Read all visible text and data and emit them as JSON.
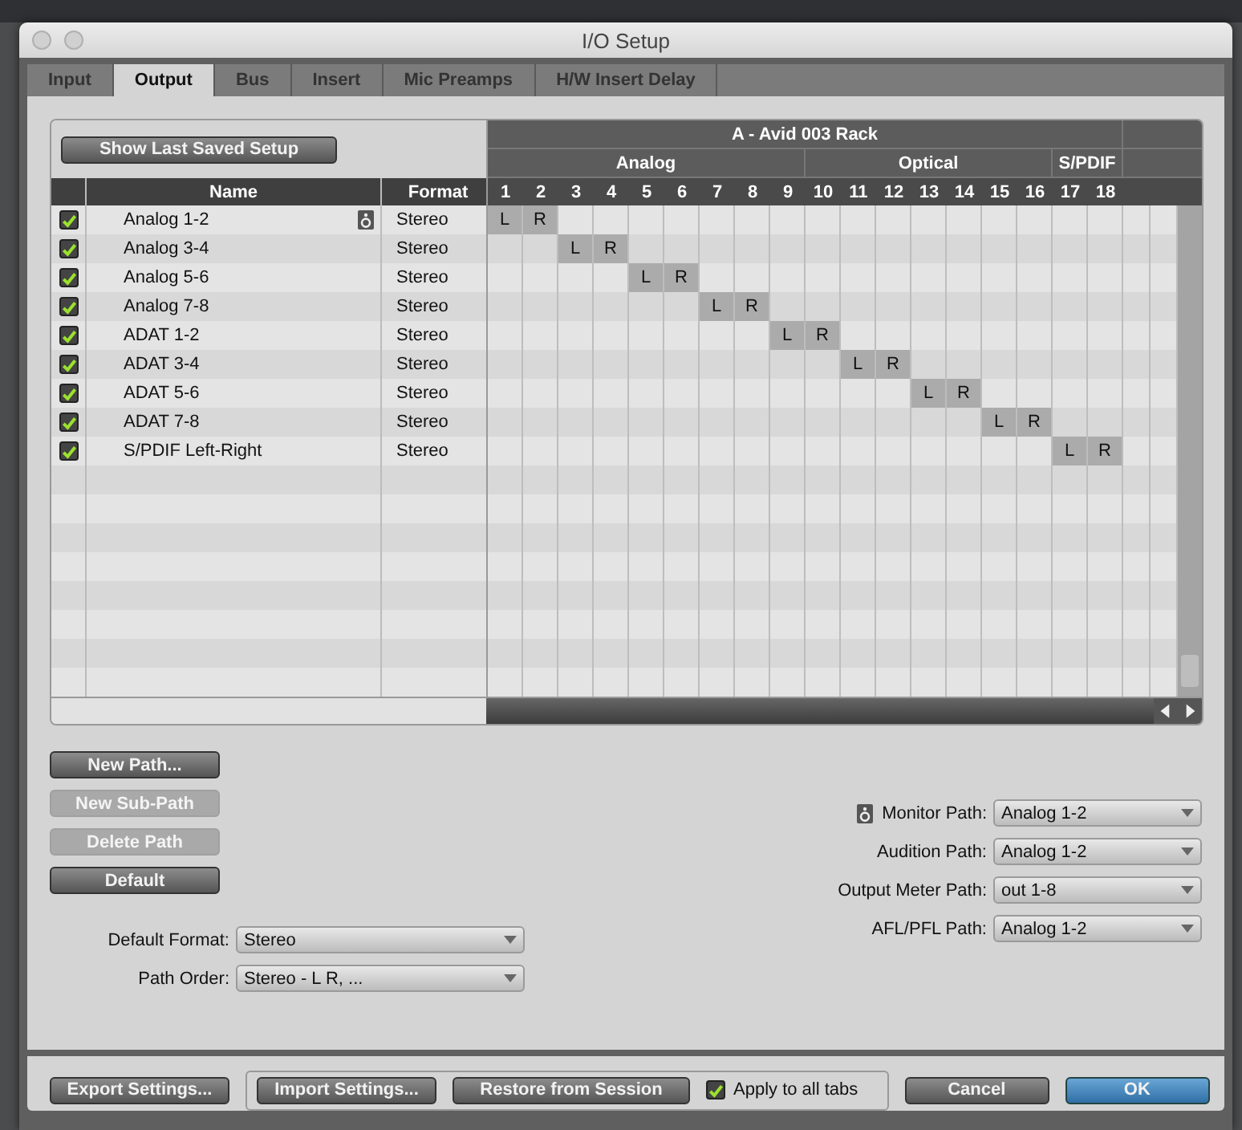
{
  "window": {
    "title": "I/O Setup"
  },
  "tabs": [
    {
      "label": "Input",
      "selected": false
    },
    {
      "label": "Output",
      "selected": true
    },
    {
      "label": "Bus",
      "selected": false
    },
    {
      "label": "Insert",
      "selected": false
    },
    {
      "label": "Mic Preamps",
      "selected": false
    },
    {
      "label": "H/W Insert Delay",
      "selected": false
    }
  ],
  "show_last_saved_button": "Show Last Saved Setup",
  "columns": {
    "name": "Name",
    "format": "Format"
  },
  "device": {
    "title": "A - Avid 003 Rack",
    "groups": [
      {
        "label": "Analog",
        "channels": [
          "1",
          "2",
          "3",
          "4",
          "5",
          "6",
          "7",
          "8",
          "9"
        ]
      },
      {
        "label": "Optical",
        "channels": [
          "10",
          "11",
          "12",
          "13",
          "14",
          "15",
          "16"
        ]
      },
      {
        "label": "S/PDIF",
        "channels": [
          "17",
          "18"
        ]
      }
    ]
  },
  "paths": [
    {
      "checked": true,
      "name": "Analog 1-2",
      "monitor": true,
      "format": "Stereo",
      "cells": [
        {
          "assigned": true,
          "text": "L"
        },
        {
          "assigned": true,
          "text": "R"
        },
        {
          "assigned": false
        },
        {
          "assigned": false
        },
        {
          "assigned": false
        },
        {
          "assigned": false
        },
        {
          "assigned": false
        },
        {
          "assigned": false
        },
        {
          "assigned": false
        },
        {
          "assigned": false
        },
        {
          "assigned": false
        },
        {
          "assigned": false
        },
        {
          "assigned": false
        },
        {
          "assigned": false
        },
        {
          "assigned": false
        },
        {
          "assigned": false
        },
        {
          "assigned": false
        },
        {
          "assigned": false
        }
      ]
    },
    {
      "checked": true,
      "name": "Analog 3-4",
      "monitor": false,
      "format": "Stereo",
      "cells": [
        {
          "assigned": false
        },
        {
          "assigned": false
        },
        {
          "assigned": true,
          "text": "L"
        },
        {
          "assigned": true,
          "text": "R"
        },
        {
          "assigned": false
        },
        {
          "assigned": false
        },
        {
          "assigned": false
        },
        {
          "assigned": false
        },
        {
          "assigned": false
        },
        {
          "assigned": false
        },
        {
          "assigned": false
        },
        {
          "assigned": false
        },
        {
          "assigned": false
        },
        {
          "assigned": false
        },
        {
          "assigned": false
        },
        {
          "assigned": false
        },
        {
          "assigned": false
        },
        {
          "assigned": false
        }
      ]
    },
    {
      "checked": true,
      "name": "Analog 5-6",
      "monitor": false,
      "format": "Stereo",
      "cells": [
        {
          "assigned": false
        },
        {
          "assigned": false
        },
        {
          "assigned": false
        },
        {
          "assigned": false
        },
        {
          "assigned": true,
          "text": "L"
        },
        {
          "assigned": true,
          "text": "R"
        },
        {
          "assigned": false
        },
        {
          "assigned": false
        },
        {
          "assigned": false
        },
        {
          "assigned": false
        },
        {
          "assigned": false
        },
        {
          "assigned": false
        },
        {
          "assigned": false
        },
        {
          "assigned": false
        },
        {
          "assigned": false
        },
        {
          "assigned": false
        },
        {
          "assigned": false
        },
        {
          "assigned": false
        }
      ]
    },
    {
      "checked": true,
      "name": "Analog 7-8",
      "monitor": false,
      "format": "Stereo",
      "cells": [
        {
          "assigned": false
        },
        {
          "assigned": false
        },
        {
          "assigned": false
        },
        {
          "assigned": false
        },
        {
          "assigned": false
        },
        {
          "assigned": false
        },
        {
          "assigned": true,
          "text": "L"
        },
        {
          "assigned": true,
          "text": "R"
        },
        {
          "assigned": false
        },
        {
          "assigned": false
        },
        {
          "assigned": false
        },
        {
          "assigned": false
        },
        {
          "assigned": false
        },
        {
          "assigned": false
        },
        {
          "assigned": false
        },
        {
          "assigned": false
        },
        {
          "assigned": false
        },
        {
          "assigned": false
        }
      ]
    },
    {
      "checked": true,
      "name": "ADAT 1-2",
      "monitor": false,
      "format": "Stereo",
      "cells": [
        {
          "assigned": false
        },
        {
          "assigned": false
        },
        {
          "assigned": false
        },
        {
          "assigned": false
        },
        {
          "assigned": false
        },
        {
          "assigned": false
        },
        {
          "assigned": false
        },
        {
          "assigned": false
        },
        {
          "assigned": true,
          "text": "L"
        },
        {
          "assigned": true,
          "text": "R"
        },
        {
          "assigned": false
        },
        {
          "assigned": false
        },
        {
          "assigned": false
        },
        {
          "assigned": false
        },
        {
          "assigned": false
        },
        {
          "assigned": false
        },
        {
          "assigned": false
        },
        {
          "assigned": false
        }
      ]
    },
    {
      "checked": true,
      "name": "ADAT 3-4",
      "monitor": false,
      "format": "Stereo",
      "cells": [
        {
          "assigned": false
        },
        {
          "assigned": false
        },
        {
          "assigned": false
        },
        {
          "assigned": false
        },
        {
          "assigned": false
        },
        {
          "assigned": false
        },
        {
          "assigned": false
        },
        {
          "assigned": false
        },
        {
          "assigned": false
        },
        {
          "assigned": false
        },
        {
          "assigned": true,
          "text": "L"
        },
        {
          "assigned": true,
          "text": "R"
        },
        {
          "assigned": false
        },
        {
          "assigned": false
        },
        {
          "assigned": false
        },
        {
          "assigned": false
        },
        {
          "assigned": false
        },
        {
          "assigned": false
        }
      ]
    },
    {
      "checked": true,
      "name": "ADAT 5-6",
      "monitor": false,
      "format": "Stereo",
      "cells": [
        {
          "assigned": false
        },
        {
          "assigned": false
        },
        {
          "assigned": false
        },
        {
          "assigned": false
        },
        {
          "assigned": false
        },
        {
          "assigned": false
        },
        {
          "assigned": false
        },
        {
          "assigned": false
        },
        {
          "assigned": false
        },
        {
          "assigned": false
        },
        {
          "assigned": false
        },
        {
          "assigned": false
        },
        {
          "assigned": true,
          "text": "L"
        },
        {
          "assigned": true,
          "text": "R"
        },
        {
          "assigned": false
        },
        {
          "assigned": false
        },
        {
          "assigned": false
        },
        {
          "assigned": false
        }
      ]
    },
    {
      "checked": true,
      "name": "ADAT 7-8",
      "monitor": false,
      "format": "Stereo",
      "cells": [
        {
          "assigned": false
        },
        {
          "assigned": false
        },
        {
          "assigned": false
        },
        {
          "assigned": false
        },
        {
          "assigned": false
        },
        {
          "assigned": false
        },
        {
          "assigned": false
        },
        {
          "assigned": false
        },
        {
          "assigned": false
        },
        {
          "assigned": false
        },
        {
          "assigned": false
        },
        {
          "assigned": false
        },
        {
          "assigned": false
        },
        {
          "assigned": false
        },
        {
          "assigned": true,
          "text": "L"
        },
        {
          "assigned": true,
          "text": "R"
        },
        {
          "assigned": false
        },
        {
          "assigned": false
        }
      ]
    },
    {
      "checked": true,
      "name": "S/PDIF Left-Right",
      "monitor": false,
      "format": "Stereo",
      "cells": [
        {
          "assigned": false
        },
        {
          "assigned": false
        },
        {
          "assigned": false
        },
        {
          "assigned": false
        },
        {
          "assigned": false
        },
        {
          "assigned": false
        },
        {
          "assigned": false
        },
        {
          "assigned": false
        },
        {
          "assigned": false
        },
        {
          "assigned": false
        },
        {
          "assigned": false
        },
        {
          "assigned": false
        },
        {
          "assigned": false
        },
        {
          "assigned": false
        },
        {
          "assigned": false
        },
        {
          "assigned": false
        },
        {
          "assigned": true,
          "text": "L"
        },
        {
          "assigned": true,
          "text": "R"
        }
      ]
    }
  ],
  "path_buttons": [
    {
      "label": "New Path...",
      "disabled": false
    },
    {
      "label": "New Sub-Path",
      "disabled": true
    },
    {
      "label": "Delete Path",
      "disabled": true
    },
    {
      "label": "Default",
      "disabled": false
    }
  ],
  "left_options": [
    {
      "label": "Default Format:",
      "value": "Stereo"
    },
    {
      "label": "Path Order:",
      "value": "Stereo - L R, ..."
    }
  ],
  "right_options": [
    {
      "label": "Monitor Path:",
      "value": "Analog 1-2",
      "monitor": true
    },
    {
      "label": "Audition Path:",
      "value": "Analog 1-2",
      "monitor": false
    },
    {
      "label": "Output Meter Path:",
      "value": "out 1-8",
      "monitor": false
    },
    {
      "label": "AFL/PFL Path:",
      "value": "Analog 1-2",
      "monitor": false
    }
  ],
  "footer": {
    "export": "Export Settings...",
    "import": "Import Settings...",
    "restore": "Restore from Session",
    "apply_all": {
      "label": "Apply to all tabs",
      "checked": true
    },
    "cancel": "Cancel",
    "ok": "OK"
  }
}
